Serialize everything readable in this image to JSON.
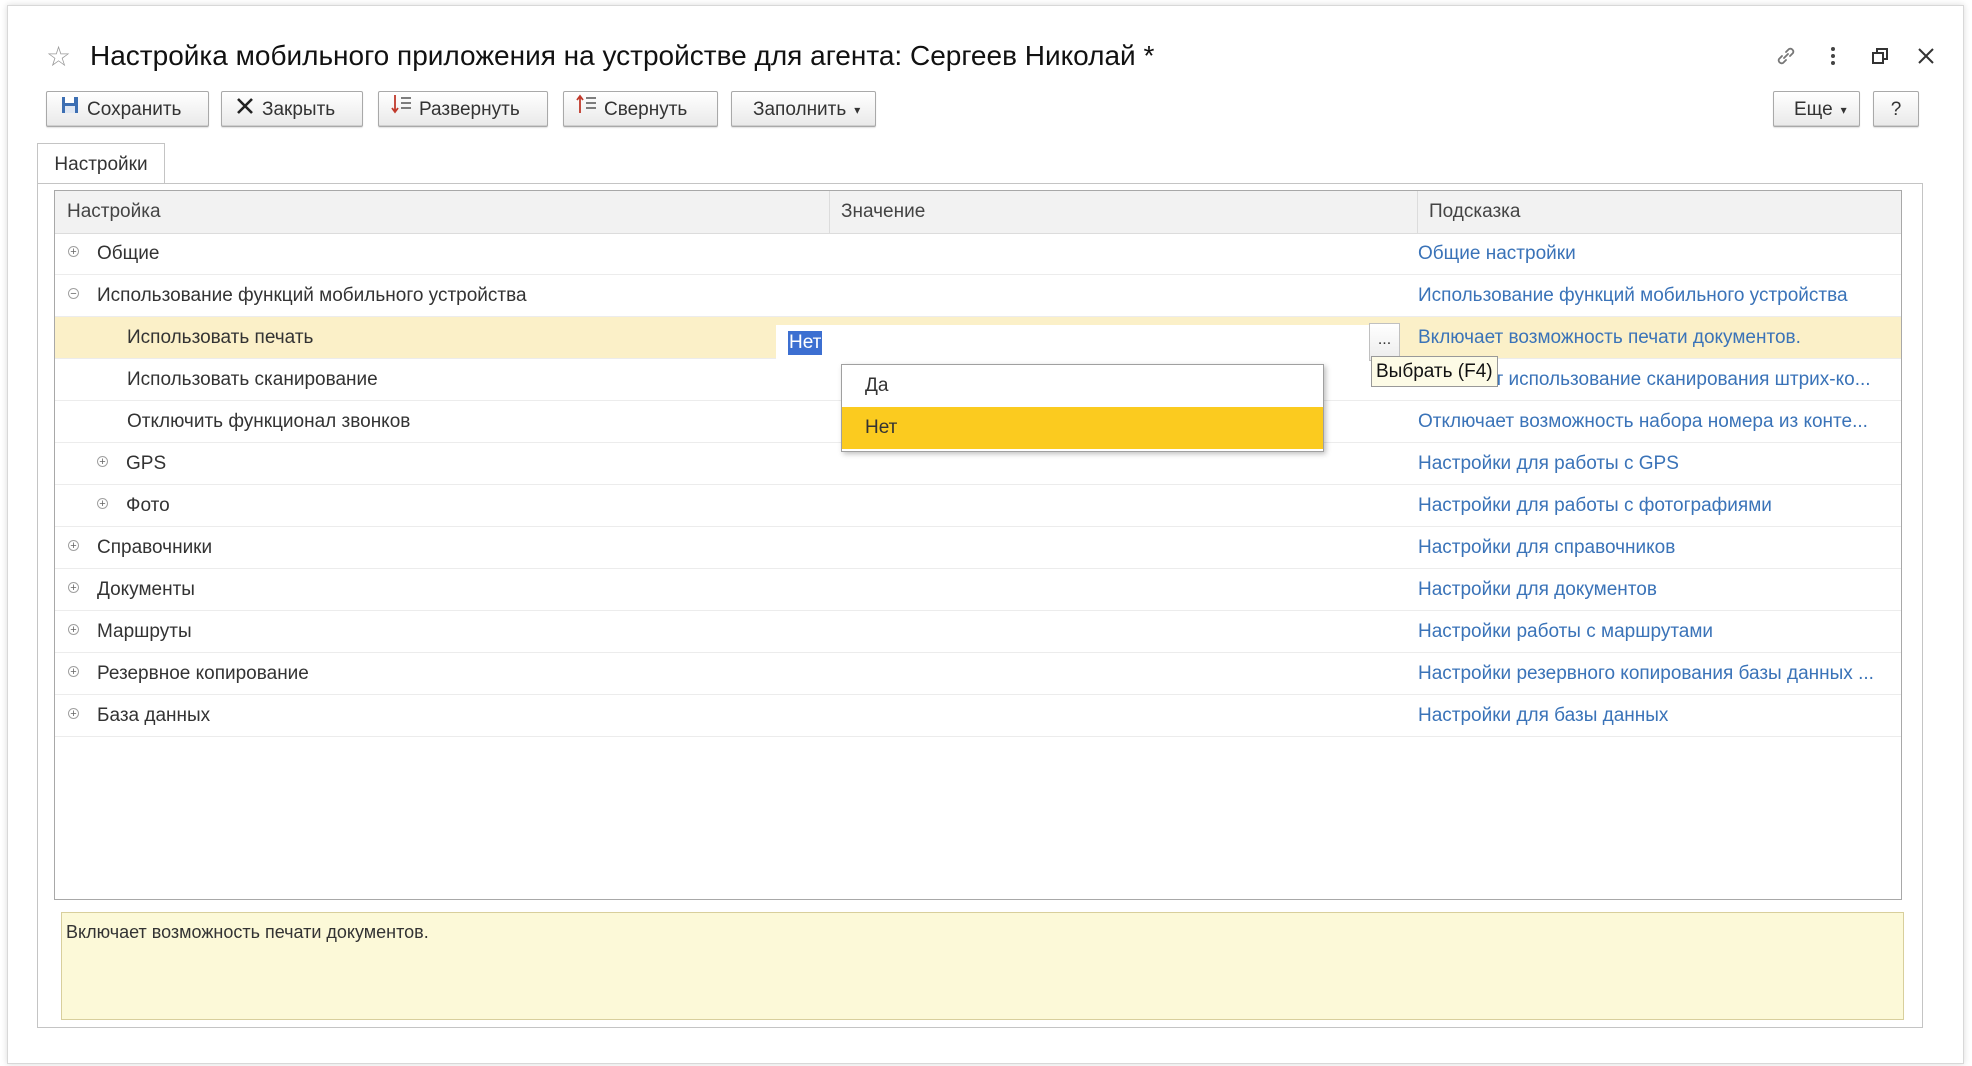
{
  "window": {
    "title": "Настройка мобильного приложения на устройстве для агента: Сергеев Николай *"
  },
  "toolbar": {
    "save": "Сохранить",
    "close": "Закрыть",
    "expand": "Развернуть",
    "collapse": "Свернуть",
    "fill": "Заполнить",
    "more": "Еще",
    "help": "?"
  },
  "tabs": [
    {
      "label": "Настройки",
      "active": true
    }
  ],
  "grid": {
    "columns": [
      "Настройка",
      "Значение",
      "Подсказка"
    ],
    "rows": [
      {
        "name": "Общие",
        "hint": "Общие настройки",
        "level": 0,
        "expander": "plus"
      },
      {
        "name": "Использование функций мобильного устройства",
        "hint": "Использование функций мобильного устройства",
        "level": 0,
        "expander": "minus"
      },
      {
        "name": "Использовать печать",
        "hint": "Включает возможность печати документов.",
        "level": 1,
        "expander": "none",
        "selected": true,
        "value": "Нет"
      },
      {
        "name": "Использовать сканирование",
        "hint": "Включает использование сканирования штрих-ко...",
        "level": 1,
        "expander": "none"
      },
      {
        "name": "Отключить функционал звонков",
        "hint": "Отключает возможность набора номера из конте...",
        "level": 1,
        "expander": "none"
      },
      {
        "name": "GPS",
        "hint": "Настройки для работы с GPS",
        "level": 1,
        "expander": "plus"
      },
      {
        "name": "Фото",
        "hint": "Настройки для работы с фотографиями",
        "level": 1,
        "expander": "plus"
      },
      {
        "name": "Справочники",
        "hint": "Настройки для справочников",
        "level": 0,
        "expander": "plus"
      },
      {
        "name": "Документы",
        "hint": "Настройки для документов",
        "level": 0,
        "expander": "plus"
      },
      {
        "name": "Маршруты",
        "hint": "Настройки работы с маршрутами",
        "level": 0,
        "expander": "plus"
      },
      {
        "name": "Резервное копирование",
        "hint": "Настройки резервного копирования базы данных ...",
        "level": 0,
        "expander": "plus"
      },
      {
        "name": "База данных",
        "hint": "Настройки для базы данных",
        "level": 0,
        "expander": "plus"
      }
    ]
  },
  "editor": {
    "value": "Нет",
    "choose_button": "...",
    "tooltip": "Выбрать (F4)",
    "options": [
      {
        "label": "Да",
        "active": false
      },
      {
        "label": "Нет",
        "active": true
      }
    ]
  },
  "description": "Включает возможность печати документов.",
  "colors": {
    "accent_link": "#3a73b8",
    "selected_row": "#fbf0c8",
    "dropdown_active": "#fbcb1f",
    "description_bg": "#fcf9d8"
  },
  "icons": {
    "favorite": "star-icon",
    "link": "link-icon",
    "menu": "more-vertical-icon",
    "restore": "restore-window-icon",
    "close": "close-icon"
  }
}
